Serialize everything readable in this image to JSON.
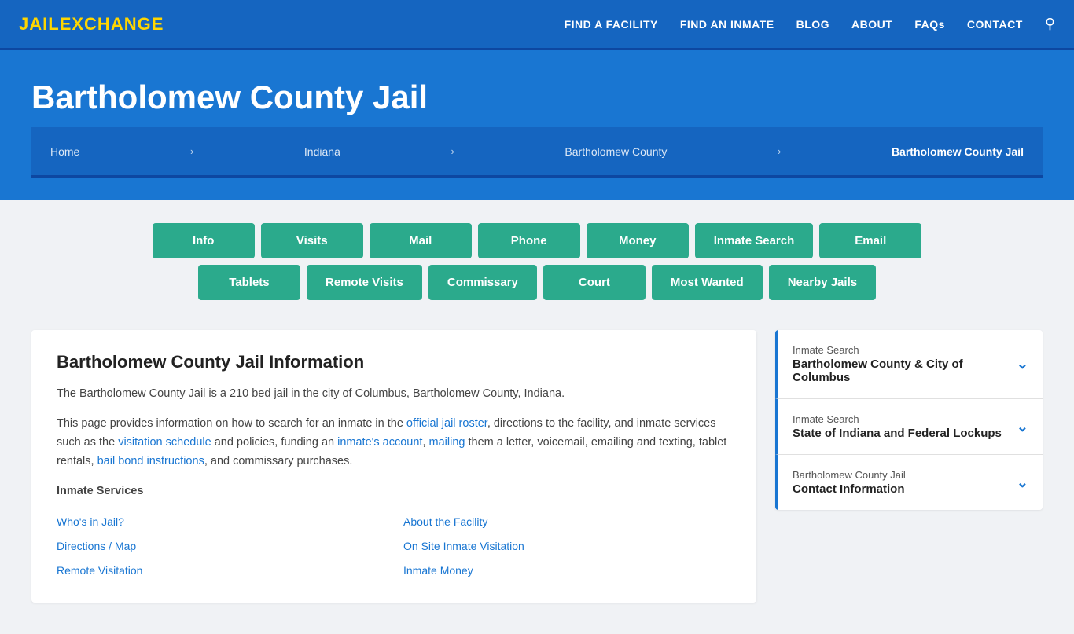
{
  "logo": {
    "part1": "JAIL",
    "part2": "EXCHANGE"
  },
  "nav": {
    "links": [
      {
        "label": "FIND A FACILITY",
        "id": "find-facility"
      },
      {
        "label": "FIND AN INMATE",
        "id": "find-inmate"
      },
      {
        "label": "BLOG",
        "id": "blog"
      },
      {
        "label": "ABOUT",
        "id": "about"
      },
      {
        "label": "FAQs",
        "id": "faqs"
      },
      {
        "label": "CONTACT",
        "id": "contact"
      }
    ]
  },
  "hero": {
    "title": "Bartholomew County Jail",
    "breadcrumb": [
      {
        "label": "Home",
        "href": "#"
      },
      {
        "label": "Indiana",
        "href": "#"
      },
      {
        "label": "Bartholomew County",
        "href": "#"
      },
      {
        "label": "Bartholomew County Jail",
        "current": true
      }
    ]
  },
  "tabs": {
    "row1": [
      {
        "label": "Info"
      },
      {
        "label": "Visits"
      },
      {
        "label": "Mail"
      },
      {
        "label": "Phone"
      },
      {
        "label": "Money"
      },
      {
        "label": "Inmate Search"
      },
      {
        "label": "Email"
      }
    ],
    "row2": [
      {
        "label": "Tablets"
      },
      {
        "label": "Remote Visits"
      },
      {
        "label": "Commissary"
      },
      {
        "label": "Court"
      },
      {
        "label": "Most Wanted"
      },
      {
        "label": "Nearby Jails"
      }
    ]
  },
  "info": {
    "title": "Bartholomew County Jail Information",
    "para1": "The Bartholomew County Jail is a 210 bed jail in the city of Columbus, Bartholomew County, Indiana.",
    "para2_before": "This page provides information on how to search for an inmate in the ",
    "para2_link1": "official jail roster",
    "para2_middle": ", directions to the facility, and inmate services such as the ",
    "para2_link2": "visitation schedule",
    "para2_middle2": " and policies, funding an ",
    "para2_link3": "inmate's account",
    "para2_comma": ", ",
    "para2_link4": "mailing",
    "para2_end": " them a letter, voicemail, emailing and texting, tablet rentals, ",
    "para2_link5": "bail bond instructions",
    "para2_end2": ", and commissary purchases.",
    "services_title": "Inmate Services",
    "services": [
      {
        "label": "Who's in Jail?",
        "col": 0
      },
      {
        "label": "About the Facility",
        "col": 1
      },
      {
        "label": "Directions / Map",
        "col": 0
      },
      {
        "label": "On Site Inmate Visitation",
        "col": 1
      },
      {
        "label": "Remote Visitation",
        "col": 0
      },
      {
        "label": "Inmate Money",
        "col": 1
      }
    ]
  },
  "sidebar": {
    "cards": [
      {
        "label": "Inmate Search",
        "title": "Bartholomew County & City of Columbus"
      },
      {
        "label": "Inmate Search",
        "title": "State of Indiana and Federal Lockups"
      },
      {
        "label": "Bartholomew County Jail",
        "title": "Contact Information"
      }
    ]
  }
}
